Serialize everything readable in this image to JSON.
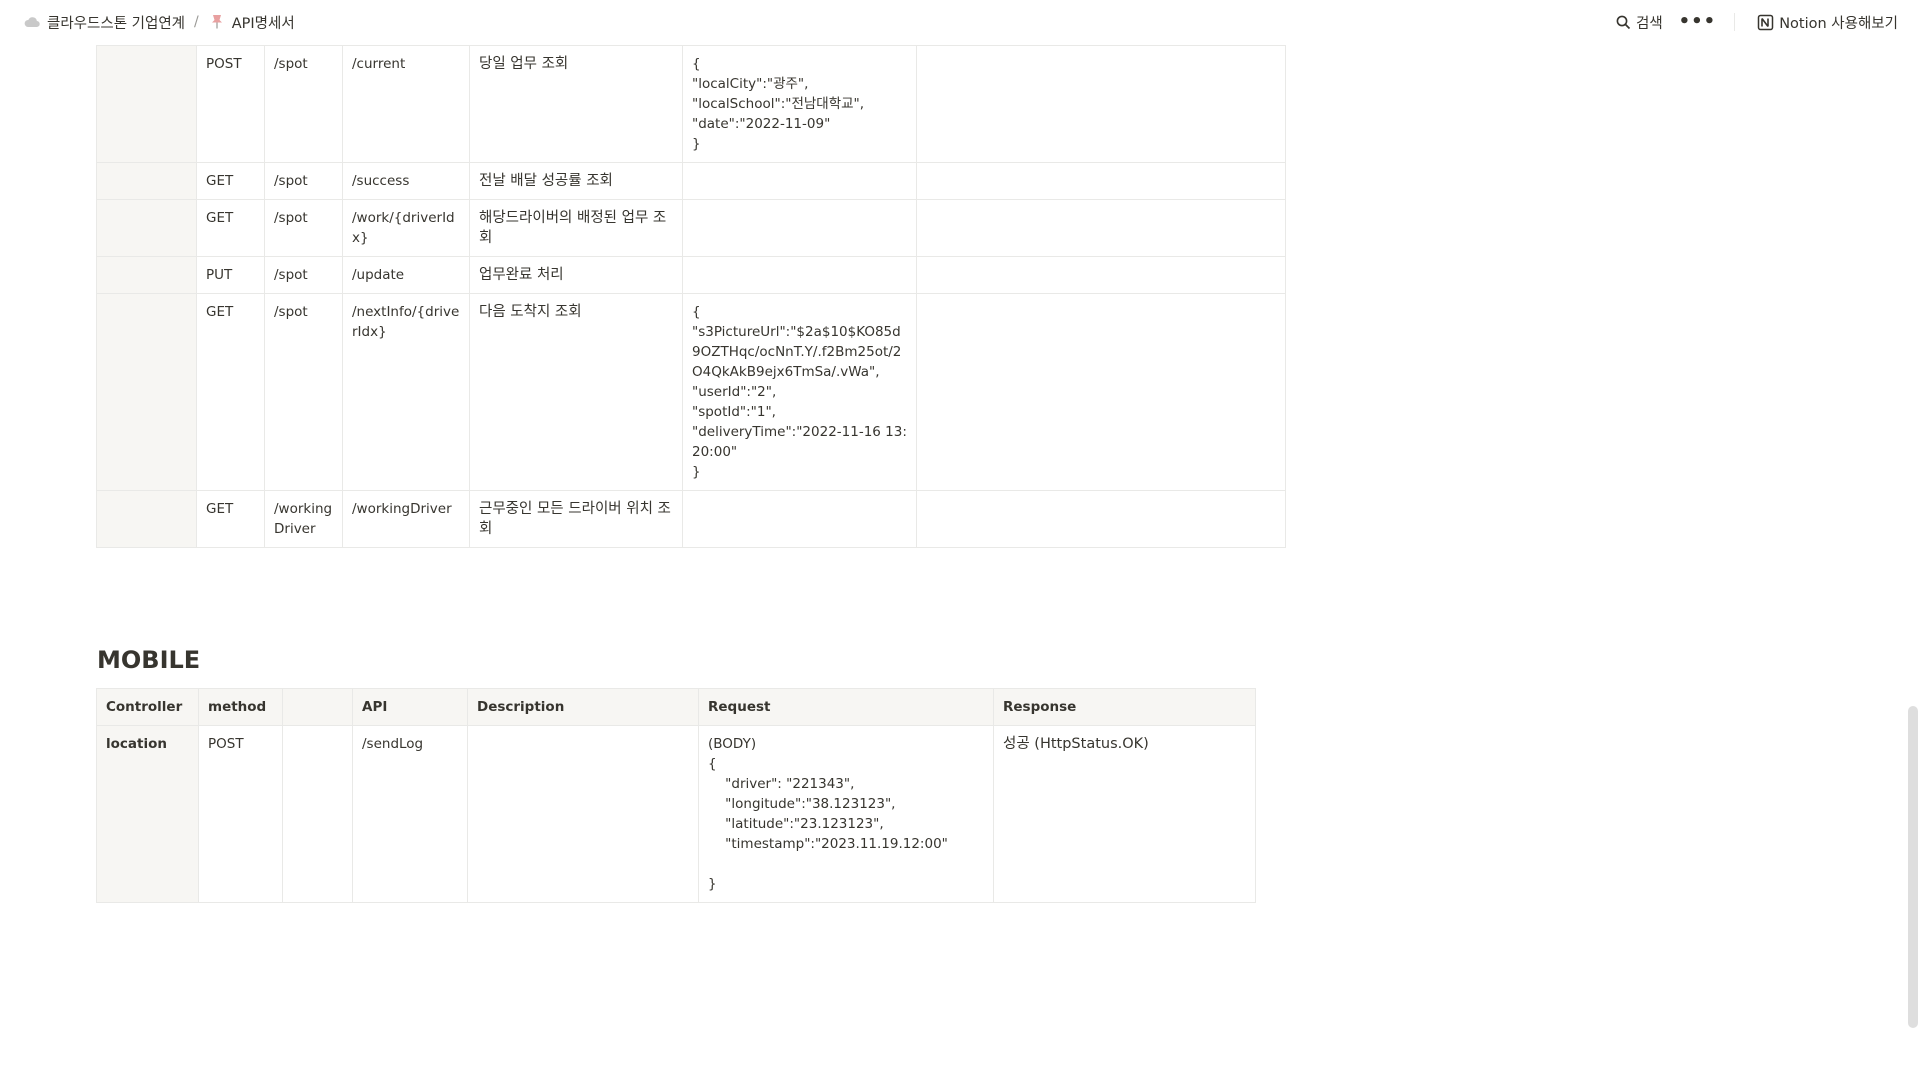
{
  "breadcrumb": [
    {
      "label": "클라우드스톤 기업연계",
      "icon": "cloud-icon"
    },
    {
      "label": "API명세서",
      "icon": "pin-icon"
    }
  ],
  "breadcrumb_separator": "/",
  "topbar": {
    "search_label": "검색",
    "more_label": "•••",
    "notion_label": "Notion 사용해보기"
  },
  "spot_table": {
    "rows": [
      {
        "controller": "",
        "method": "POST",
        "prefix": "/spot",
        "api": "/current",
        "description": "당일 업무 조회",
        "request": "{\n\"localCity\":\"광주\",\n\"localSchool\":\"전남대학교\",\n\"date\":\"2022-11-09\"\n}",
        "response": ""
      },
      {
        "controller": "",
        "method": "GET",
        "prefix": "/spot",
        "api": "/success",
        "description": "전날 배달 성공률 조회",
        "request": "",
        "response": ""
      },
      {
        "controller": "",
        "method": "GET",
        "prefix": "/spot",
        "api": "/work/{driverIdx}",
        "description": "해당드라이버의 배정된 업무 조회",
        "request": "",
        "response": ""
      },
      {
        "controller": "",
        "method": "PUT",
        "prefix": "/spot",
        "api": "/update",
        "description": "업무완료 처리",
        "request": "",
        "response": ""
      },
      {
        "controller": "",
        "method": "GET",
        "prefix": "/spot",
        "api": "/nextInfo/{driverIdx}",
        "description": "다음 도착지 조회",
        "request": "{\n\"s3PictureUrl\":\"$2a$10$KO85d9OZTHqc/ocNnT.Y/.f2Bm25ot/2O4QkAkB9ejx6TmSa/.vWa\",\n\"userId\":\"2\",\n\"spotId\":\"1\",\n\"deliveryTime\":\"2022-11-16 13:20:00\"\n}",
        "response": ""
      },
      {
        "controller": "",
        "method": "GET",
        "prefix": "/working Driver",
        "api": "/workingDriver",
        "description": "근무중인 모든 드라이버 위치 조회",
        "request": "",
        "response": ""
      }
    ]
  },
  "mobile_section": {
    "heading": "MOBILE",
    "headers": [
      "Controller",
      "method",
      "",
      "API",
      "Description",
      "Request",
      "Response"
    ],
    "rows": [
      {
        "controller": "location",
        "method": "POST",
        "blank": "",
        "api": "/sendLog",
        "description": "",
        "request": "(BODY)\n{\n    \"driver\": \"221343\",\n    \"longitude\":\"38.123123\",\n    \"latitude\":\"23.123123\",\n    \"timestamp\":\"2023.11.19.12:00\"\n\n}",
        "response": "성공 (HttpStatus.OK)"
      }
    ]
  },
  "colors": {
    "text": "#37352f",
    "header_bg": "#f7f6f3",
    "border": "#e9e9e7",
    "muted": "#9b9a97"
  }
}
